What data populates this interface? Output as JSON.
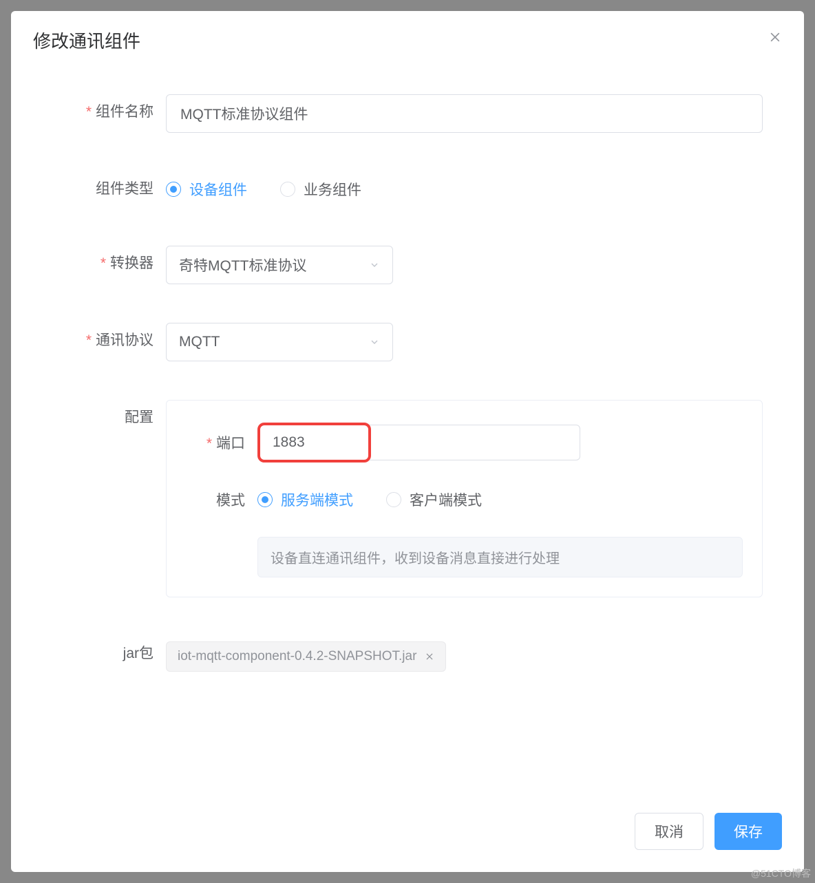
{
  "modal": {
    "title": "修改通讯组件"
  },
  "form": {
    "name_label": "组件名称",
    "name_value": "MQTT标准协议组件",
    "type_label": "组件类型",
    "type_option_device": "设备组件",
    "type_option_business": "业务组件",
    "converter_label": "转换器",
    "converter_value": "奇特MQTT标准协议",
    "protocol_label": "通讯协议",
    "protocol_value": "MQTT",
    "config_label": "配置",
    "jar_label": "jar包",
    "jar_value": "iot-mqtt-component-0.4.2-SNAPSHOT.jar"
  },
  "config": {
    "port_label": "端口",
    "port_value": "1883",
    "mode_label": "模式",
    "mode_server": "服务端模式",
    "mode_client": "客户端模式",
    "description": "设备直连通讯组件，收到设备消息直接进行处理"
  },
  "footer": {
    "cancel": "取消",
    "save": "保存"
  },
  "watermark": "@51CTO博客"
}
